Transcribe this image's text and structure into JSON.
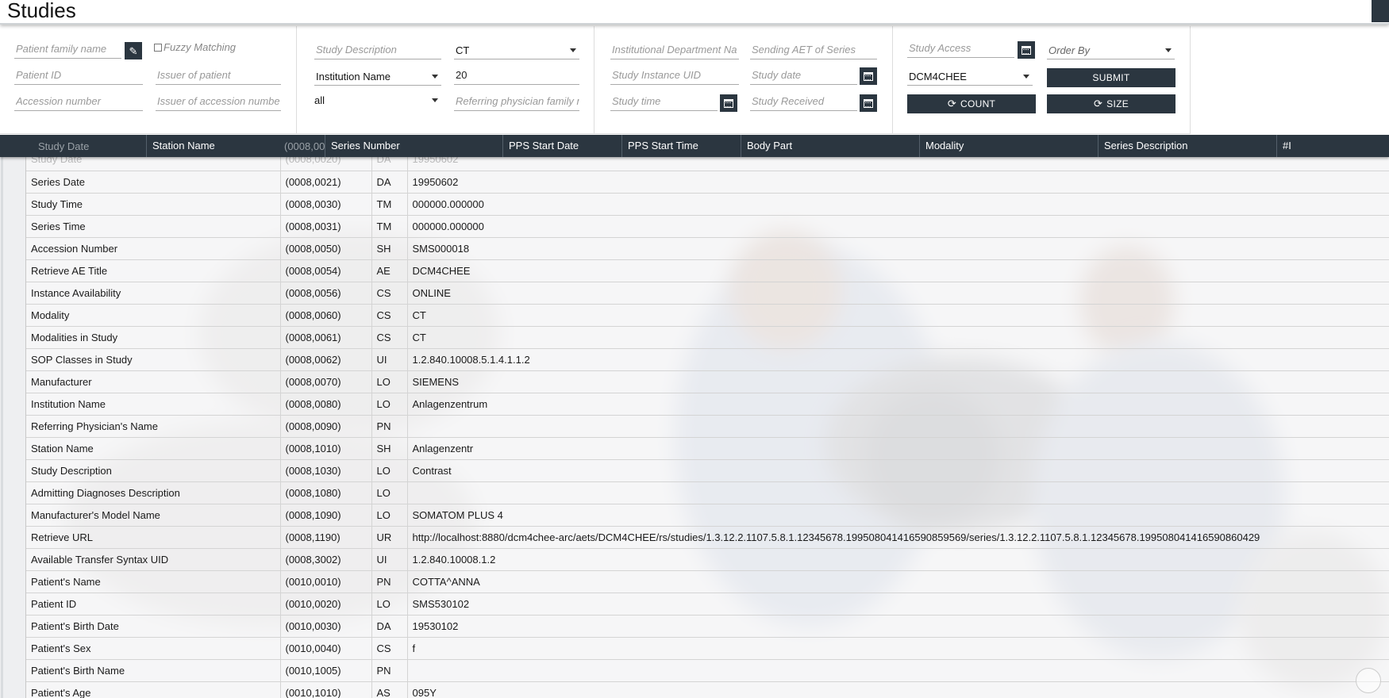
{
  "header": {
    "title": "Studies"
  },
  "filters": {
    "patient_family_name": {
      "placeholder": "Patient family name"
    },
    "fuzzy_matching_label": "Fuzzy Matching",
    "patient_id": {
      "placeholder": "Patient ID"
    },
    "issuer_of_patient": {
      "placeholder": "Issuer of patient"
    },
    "accession_number": {
      "placeholder": "Accession number"
    },
    "issuer_of_accession": {
      "placeholder": "Issuer of accession numbe"
    },
    "study_description": {
      "placeholder": "Study Description"
    },
    "modality_select": "CT",
    "institution_select": "Institution Name",
    "limit": {
      "value": "20"
    },
    "all_select": "all",
    "referring_physician": {
      "placeholder": "Referring physician family n"
    },
    "institutional_department": {
      "placeholder": "Institutional Department Na"
    },
    "sending_aet": {
      "placeholder": "Sending AET of Series"
    },
    "study_instance_uid": {
      "placeholder": "Study Instance UID"
    },
    "study_date": {
      "placeholder": "Study date"
    },
    "study_time": {
      "placeholder": "Study time"
    },
    "study_received": {
      "placeholder": "Study Received"
    },
    "study_access": {
      "placeholder": "Study Access"
    },
    "order_by": "Order By",
    "aet_select": "DCM4CHEE",
    "submit_label": "SUBMIT",
    "count_label": "COUNT",
    "size_label": "SIZE"
  },
  "columns": [
    "Station Name",
    "Series Number",
    "PPS Start Date",
    "PPS Start Time",
    "Body Part",
    "Modality",
    "Series Description",
    "#I"
  ],
  "hidden_row": {
    "name": "Study Date",
    "tag": "(0008,0020)",
    "value": "19950602"
  },
  "attributes": [
    {
      "name": "Study Date",
      "tag": "(0008,0020)",
      "vr": "DA",
      "value": "19950602"
    },
    {
      "name": "Series Date",
      "tag": "(0008,0021)",
      "vr": "DA",
      "value": "19950602"
    },
    {
      "name": "Study Time",
      "tag": "(0008,0030)",
      "vr": "TM",
      "value": "000000.000000"
    },
    {
      "name": "Series Time",
      "tag": "(0008,0031)",
      "vr": "TM",
      "value": "000000.000000"
    },
    {
      "name": "Accession Number",
      "tag": "(0008,0050)",
      "vr": "SH",
      "value": "SMS000018"
    },
    {
      "name": "Retrieve AE Title",
      "tag": "(0008,0054)",
      "vr": "AE",
      "value": "DCM4CHEE"
    },
    {
      "name": "Instance Availability",
      "tag": "(0008,0056)",
      "vr": "CS",
      "value": "ONLINE"
    },
    {
      "name": "Modality",
      "tag": "(0008,0060)",
      "vr": "CS",
      "value": "CT"
    },
    {
      "name": "Modalities in Study",
      "tag": "(0008,0061)",
      "vr": "CS",
      "value": "CT"
    },
    {
      "name": "SOP Classes in Study",
      "tag": "(0008,0062)",
      "vr": "UI",
      "value": "1.2.840.10008.5.1.4.1.1.2"
    },
    {
      "name": "Manufacturer",
      "tag": "(0008,0070)",
      "vr": "LO",
      "value": "SIEMENS"
    },
    {
      "name": "Institution Name",
      "tag": "(0008,0080)",
      "vr": "LO",
      "value": "Anlagenzentrum"
    },
    {
      "name": "Referring Physician's Name",
      "tag": "(0008,0090)",
      "vr": "PN",
      "value": ""
    },
    {
      "name": "Station Name",
      "tag": "(0008,1010)",
      "vr": "SH",
      "value": "Anlagenzentr"
    },
    {
      "name": "Study Description",
      "tag": "(0008,1030)",
      "vr": "LO",
      "value": "Contrast"
    },
    {
      "name": "Admitting Diagnoses Description",
      "tag": "(0008,1080)",
      "vr": "LO",
      "value": ""
    },
    {
      "name": "Manufacturer's Model Name",
      "tag": "(0008,1090)",
      "vr": "LO",
      "value": "SOMATOM PLUS 4"
    },
    {
      "name": "Retrieve URL",
      "tag": "(0008,1190)",
      "vr": "UR",
      "value": "http://localhost:8880/dcm4chee-arc/aets/DCM4CHEE/rs/studies/1.3.12.2.1107.5.8.1.12345678.199508041416590859569/series/1.3.12.2.1107.5.8.1.12345678.199508041416590860429"
    },
    {
      "name": "Available Transfer Syntax UID",
      "tag": "(0008,3002)",
      "vr": "UI",
      "value": "1.2.840.10008.1.2"
    },
    {
      "name": "Patient's Name",
      "tag": "(0010,0010)",
      "vr": "PN",
      "value": "COTTA^ANNA"
    },
    {
      "name": "Patient ID",
      "tag": "(0010,0020)",
      "vr": "LO",
      "value": "SMS530102"
    },
    {
      "name": "Patient's Birth Date",
      "tag": "(0010,0030)",
      "vr": "DA",
      "value": "19530102"
    },
    {
      "name": "Patient's Sex",
      "tag": "(0010,0040)",
      "vr": "CS",
      "value": "f"
    },
    {
      "name": "Patient's Birth Name",
      "tag": "(0010,1005)",
      "vr": "PN",
      "value": ""
    },
    {
      "name": "Patient's Age",
      "tag": "(0010,1010)",
      "vr": "AS",
      "value": "095Y"
    },
    {
      "name": "",
      "tag": "",
      "vr": "",
      "value": ""
    }
  ],
  "colors": {
    "dark": "#2b3640",
    "row_bg": "#f4f4f5",
    "border": "#d4d4d4"
  }
}
